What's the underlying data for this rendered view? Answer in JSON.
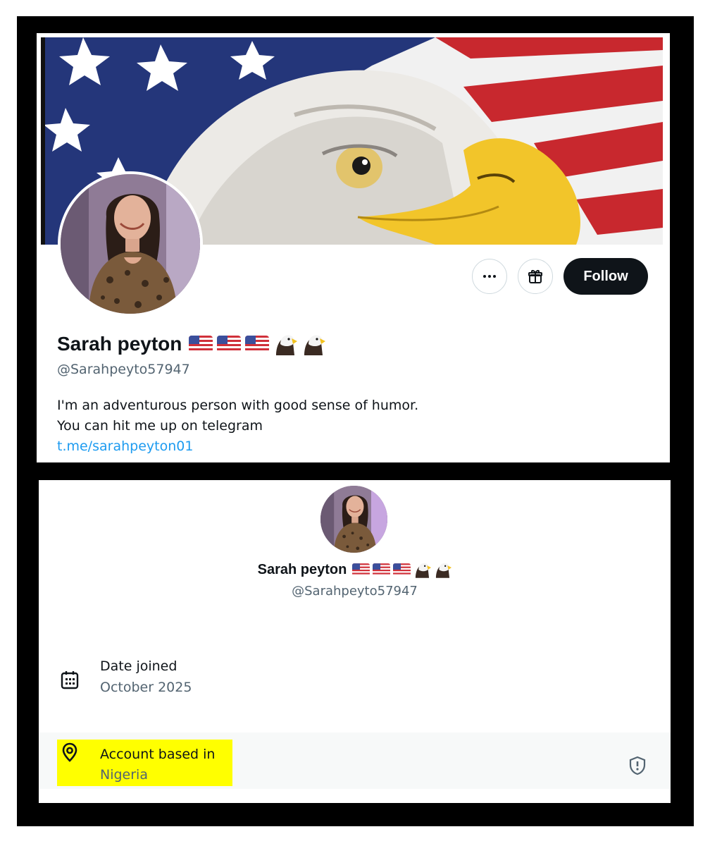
{
  "profile": {
    "display_name": "Sarah peyton",
    "name_emojis": [
      "us-flag",
      "us-flag",
      "us-flag",
      "eagle",
      "eagle"
    ],
    "handle": "@Sarahpeyto57947",
    "bio_line1": "I'm an adventurous person with good sense of humor.",
    "bio_line2": "You can hit me up on telegram",
    "bio_link": "t.me/sarahpeyton01",
    "banner_image": "bald-eagle-over-american-flag",
    "avatar_image": "woman-in-leopard-print-top"
  },
  "actions": {
    "more_icon": "more-dots-icon",
    "gift_icon": "gift-icon",
    "follow_label": "Follow"
  },
  "about": {
    "display_name": "Sarah peyton",
    "handle": "@Sarahpeyto57947",
    "joined_label": "Date joined",
    "joined_value": "October 2025",
    "joined_icon": "calendar-icon",
    "based_label": "Account based in",
    "based_value": "Nigeria",
    "based_icon": "location-pin-icon",
    "verify_icon": "shield-alert-icon",
    "highlight_color": "#ffff00"
  },
  "colors": {
    "text": "#0f1419",
    "secondary": "#536471",
    "link": "#1d9bf0",
    "follow_bg": "#0f1419"
  }
}
